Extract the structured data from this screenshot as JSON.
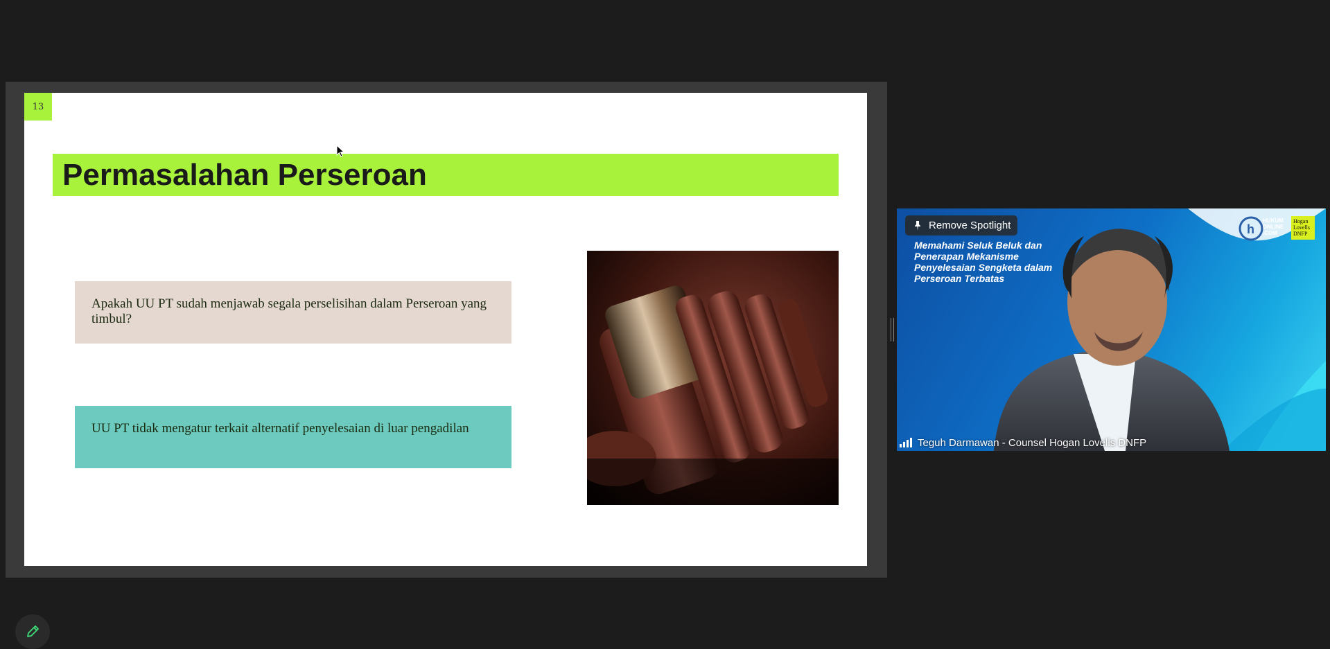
{
  "slide": {
    "number": "13",
    "title": "Permasalahan Perseroan",
    "boxes": [
      "Apakah UU PT sudah menjawab segala perselisihan dalam Perseroan yang timbul?",
      "UU PT tidak mengatur terkait alternatif penyelesaian di luar pengadilan"
    ],
    "image": "gavel-photo",
    "accent_color": "#a8f23c"
  },
  "video": {
    "spotlight_button": "Remove Spotlight",
    "headline": "Memahami Seluk Beluk dan Penerapan Mekanisme Penyelesaian Sengketa dalam Perseroan Terbatas",
    "logo_text": "HUKUM ONLINE .COM",
    "partner_logo": "Hogan Lovells DNFP",
    "participant_name": "Teguh Darmawan - Counsel Hogan Lovells DNFP"
  },
  "controls": {
    "annotate_icon": "pencil-icon"
  }
}
